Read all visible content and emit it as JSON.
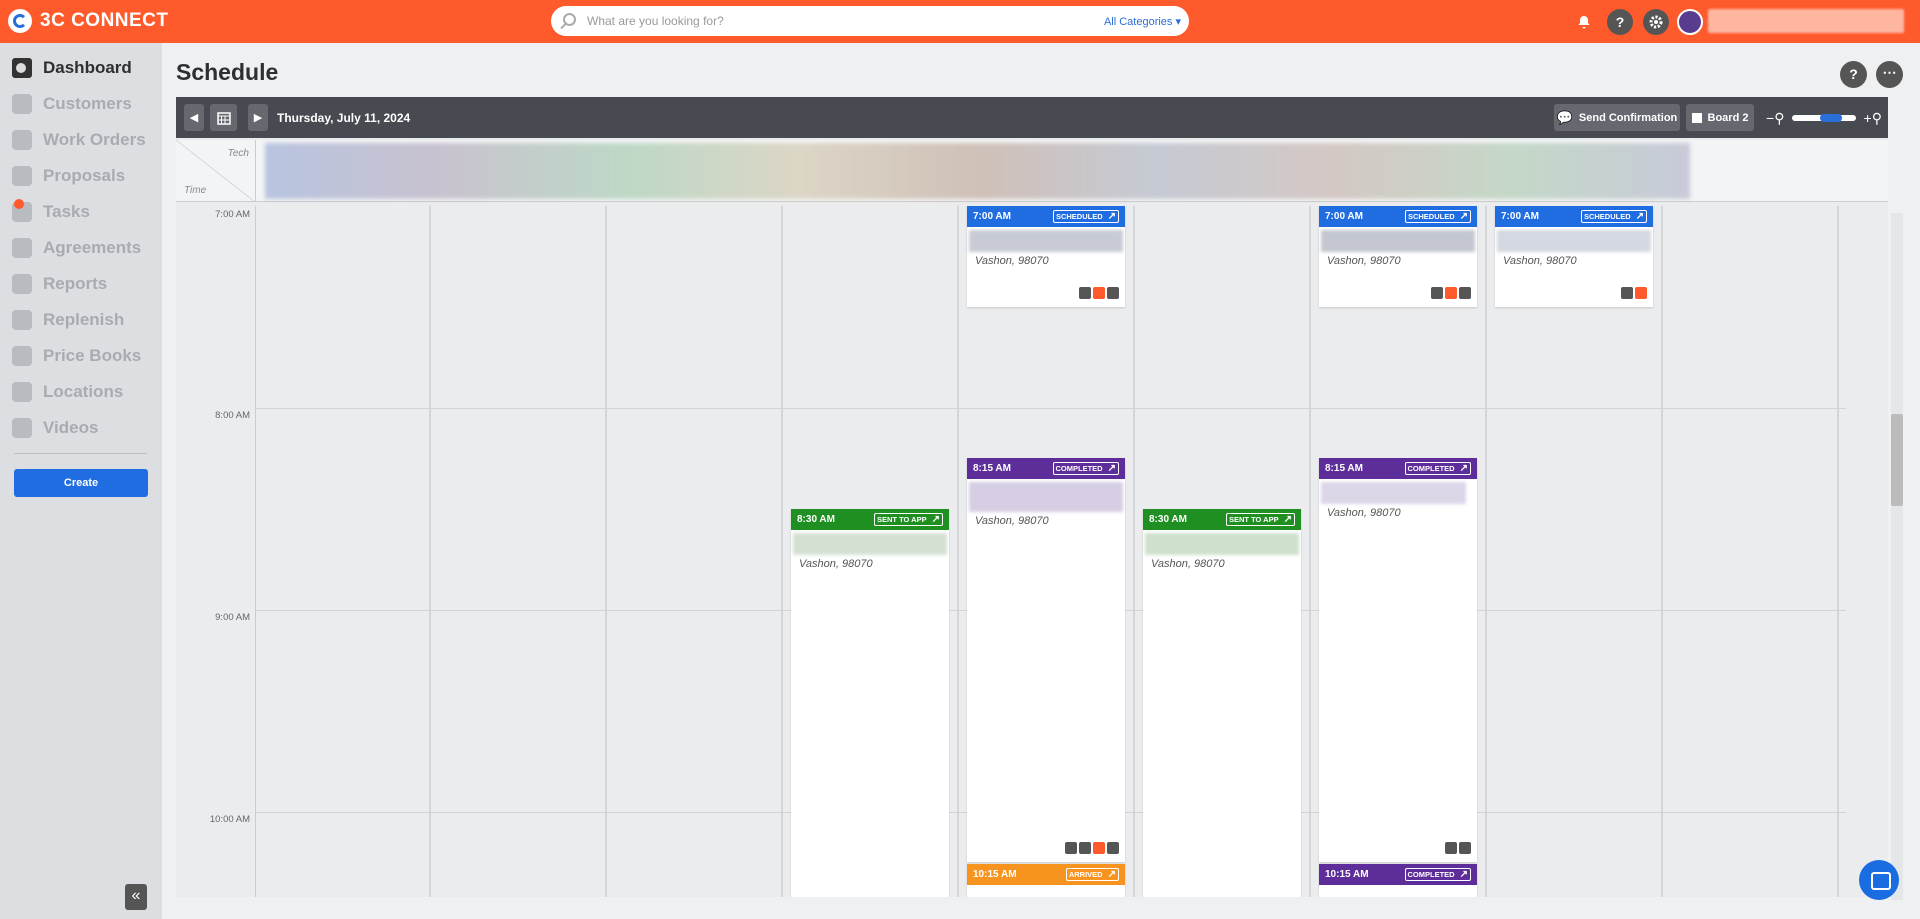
{
  "app": {
    "name": "3C CONNECT"
  },
  "search": {
    "placeholder": "What are you looking for?",
    "category": "All Categories ▾"
  },
  "sidebar": {
    "items": [
      {
        "label": "Dashboard"
      },
      {
        "label": "Customers"
      },
      {
        "label": "Work Orders"
      },
      {
        "label": "Proposals"
      },
      {
        "label": "Tasks"
      },
      {
        "label": "Agreements"
      },
      {
        "label": "Reports"
      },
      {
        "label": "Replenish"
      },
      {
        "label": "Price Books"
      },
      {
        "label": "Locations"
      },
      {
        "label": "Videos"
      }
    ],
    "create_label": "Create",
    "collapse_label": "«"
  },
  "page": {
    "title": "Schedule",
    "help": "?",
    "more": "⋯"
  },
  "toolbar": {
    "date": "Thursday, July 11, 2024",
    "send_confirmation": "Send Confirmation",
    "board": "Board 2",
    "zoom_out": "−",
    "zoom_in": "+"
  },
  "header": {
    "tech_label": "Tech",
    "time_label": "Time"
  },
  "times": [
    "7:00 AM",
    "8:00 AM",
    "9:00 AM",
    "10:00 AM"
  ],
  "cards": [
    {
      "time": "7:00 AM",
      "status": "SCHEDULED",
      "city": "Vashon, 98070",
      "color": "#1f6de0"
    },
    {
      "time": "7:00 AM",
      "status": "SCHEDULED",
      "city": "Vashon, 98070",
      "color": "#1f6de0"
    },
    {
      "time": "7:00 AM",
      "status": "SCHEDULED",
      "city": "Vashon, 98070",
      "color": "#1f6de0"
    },
    {
      "time": "8:15 AM",
      "status": "COMPLETED",
      "city": "Vashon, 98070",
      "color": "#5d2e99"
    },
    {
      "time": "8:15 AM",
      "status": "COMPLETED",
      "city": "Vashon, 98070",
      "color": "#5d2e99"
    },
    {
      "time": "8:30 AM",
      "status": "SENT TO APP",
      "city": "Vashon, 98070",
      "color": "#1f8f22"
    },
    {
      "time": "8:30 AM",
      "status": "SENT TO APP",
      "city": "Vashon, 98070",
      "color": "#1f8f22"
    },
    {
      "time": "10:15 AM",
      "status": "ARRIVED",
      "color": "#f79420"
    },
    {
      "time": "10:15 AM",
      "status": "COMPLETED",
      "color": "#5d2e99"
    }
  ],
  "colors": {
    "brand": "#ff5a2c",
    "primary": "#1f6de0"
  }
}
